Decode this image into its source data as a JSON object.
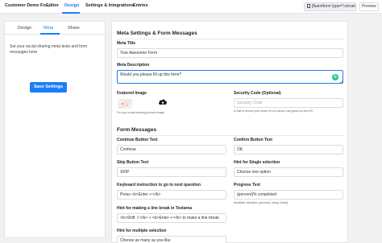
{
  "topbar": {
    "form_name": "Customer Demo Fo...",
    "nav": [
      "Editor",
      "Design",
      "Settings & Integrations",
      "Entries"
    ],
    "active_nav": "Design",
    "shortcode": "[fluentform type=\"conver",
    "preview_label": "Preview"
  },
  "sidebar": {
    "tabs": [
      "Design",
      "Meta",
      "Share"
    ],
    "active_tab": "Meta",
    "description": "Set your social sharing meta texts and form messages here",
    "save_label": "Save Settings"
  },
  "meta": {
    "section_title": "Meta Settings & Form Messages",
    "meta_title_label": "Meta Title",
    "meta_title_value": "Your Awesome Form",
    "meta_description_label": "Meta Description",
    "meta_description_value": "Would you please fill up this form?",
    "featured_image_label": "Featured Image",
    "featured_image_help": "For your social sharing preview image",
    "security_code_label": "Security Code (Optional)",
    "security_code_placeholder": "Security Code",
    "security_code_help": "A Salt to secure your share url so nobody can guess by form ID."
  },
  "messages": {
    "section_title": "Form Messages",
    "continue_label": "Continue Button Text",
    "continue_value": "Continue",
    "confirm_label": "Confirm Button Text",
    "confirm_value": "OK",
    "skip_label": "Skip Button Text",
    "skip_value": "SKIP",
    "hint_single_label": "Hint for Single selection",
    "hint_single_value": "Choose one option",
    "keyboard_label": "Keyboard instruction to go to next question",
    "keyboard_value": "Press <b>Enter ↵</b>",
    "progress_label": "Progress Text",
    "progress_value": "{percent}% completed",
    "progress_help": "Available Variables: {percent}, {step}, {total}",
    "linebreak_label": "Hint for making a line break in Textarea",
    "linebreak_value": "<b>Shift ⇧</b> + <b>Enter ↵</b> to make a line break.",
    "hint_multiple_label": "Hint for multiple selection",
    "hint_multiple_value": "Choose as many as you like"
  }
}
